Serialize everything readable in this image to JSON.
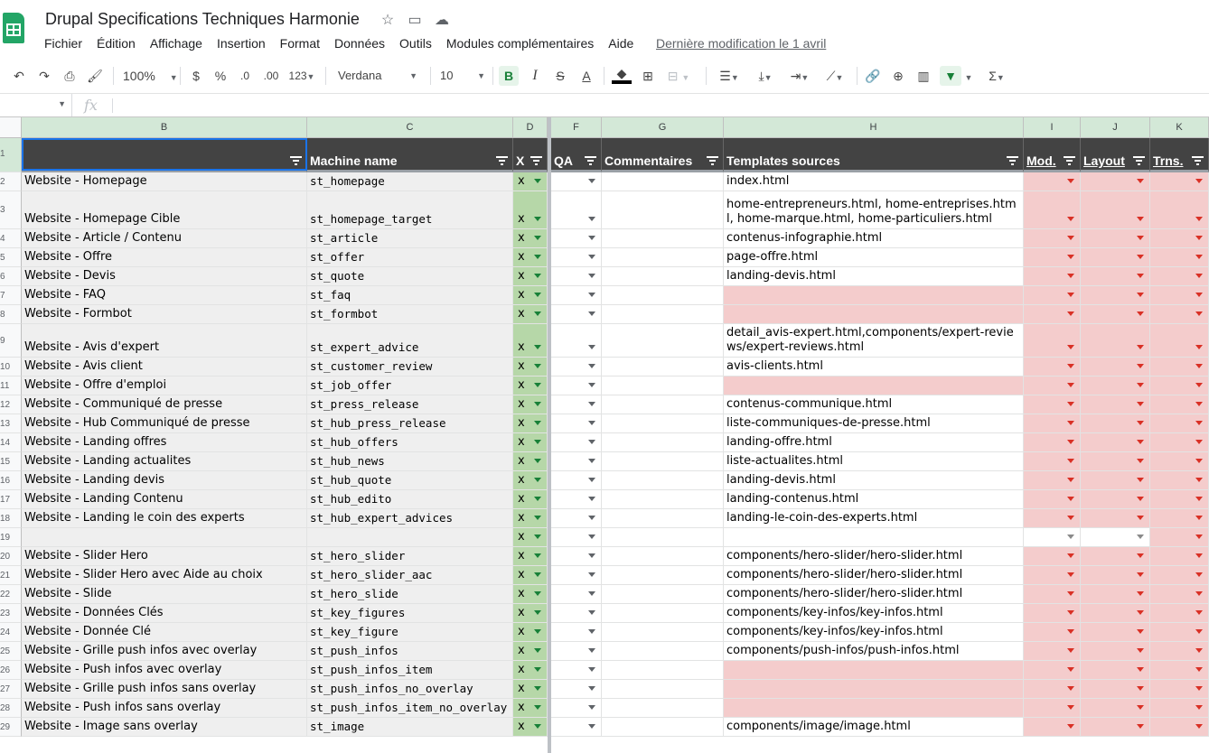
{
  "header": {
    "title": "Drupal Specifications Techniques Harmonie",
    "menus": [
      "Fichier",
      "Édition",
      "Affichage",
      "Insertion",
      "Format",
      "Données",
      "Outils",
      "Modules complémentaires",
      "Aide"
    ],
    "last_modified": "Dernière modification le 1 avril"
  },
  "toolbar": {
    "zoom": "100%",
    "currency": "$",
    "percent": "%",
    "dec_less": ".0",
    "dec_more": ".00",
    "number_format": "123",
    "font": "Verdana",
    "font_size": "10",
    "bold": "B",
    "italic": "I",
    "strike": "S",
    "text_color": "A"
  },
  "formula_bar": {
    "fx": "fx",
    "value": ""
  },
  "columns": [
    "B",
    "C",
    "D",
    "F",
    "G",
    "H",
    "I",
    "J",
    "K"
  ],
  "header_row": {
    "row_number": "1",
    "b": "",
    "c": "Machine name",
    "d": "X",
    "f": "QA",
    "g": "Commentaires",
    "h": "Templates sources",
    "i": "Mod.",
    "j": "Layout",
    "k": "Trns."
  },
  "rows": [
    {
      "n": "2",
      "b": "Website - Homepage",
      "c": "st_homepage",
      "d": "x",
      "h": "index.html",
      "h_pink": false,
      "ij_pink": true
    },
    {
      "n": "3",
      "b": "Website - Homepage Cible",
      "c": "st_homepage_target",
      "d": "x",
      "h": "home-entrepreneurs.html, home-entreprises.html, home-marque.html, home-particuliers.html",
      "h_pink": false,
      "ij_pink": true
    },
    {
      "n": "4",
      "b": "Website - Article / Contenu",
      "c": "st_article",
      "d": "x",
      "h": "contenus-infographie.html",
      "h_pink": false,
      "ij_pink": true
    },
    {
      "n": "5",
      "b": "Website - Offre",
      "c": "st_offer",
      "d": "x",
      "h": "page-offre.html",
      "h_pink": false,
      "ij_pink": true
    },
    {
      "n": "6",
      "b": "Website - Devis",
      "c": "st_quote",
      "d": "x",
      "h": "landing-devis.html",
      "h_pink": false,
      "ij_pink": true
    },
    {
      "n": "7",
      "b": "Website - FAQ",
      "c": "st_faq",
      "d": "x",
      "h": "",
      "h_pink": true,
      "ij_pink": true
    },
    {
      "n": "8",
      "b": "Website - Formbot",
      "c": "st_formbot",
      "d": "x",
      "h": "",
      "h_pink": true,
      "ij_pink": true
    },
    {
      "n": "9",
      "b": "Website - Avis d'expert",
      "c": "st_expert_advice",
      "d": "x",
      "h": "detail_avis-expert.html,components/expert-reviews/expert-reviews.html",
      "h_pink": false,
      "ij_pink": true
    },
    {
      "n": "10",
      "b": "Website - Avis client",
      "c": "st_customer_review",
      "d": "x",
      "h": "avis-clients.html",
      "h_pink": false,
      "ij_pink": true
    },
    {
      "n": "11",
      "b": "Website - Offre d'emploi",
      "c": "st_job_offer",
      "d": "x",
      "h": "",
      "h_pink": true,
      "ij_pink": true
    },
    {
      "n": "12",
      "b": "Website - Communiqué de presse",
      "c": "st_press_release",
      "d": "x",
      "h": "contenus-communique.html",
      "h_pink": false,
      "ij_pink": true
    },
    {
      "n": "13",
      "b": "Website - Hub Communiqué de presse",
      "c": "st_hub_press_release",
      "d": "x",
      "h": "liste-communiques-de-presse.html",
      "h_pink": false,
      "ij_pink": true
    },
    {
      "n": "14",
      "b": "Website - Landing offres",
      "c": "st_hub_offers",
      "d": "x",
      "h": "landing-offre.html",
      "h_pink": false,
      "ij_pink": true
    },
    {
      "n": "15",
      "b": "Website - Landing actualites",
      "c": "st_hub_news",
      "d": "x",
      "h": "liste-actualites.html",
      "h_pink": false,
      "ij_pink": true
    },
    {
      "n": "16",
      "b": "Website - Landing devis",
      "c": "st_hub_quote",
      "d": "x",
      "h": "landing-devis.html",
      "h_pink": false,
      "ij_pink": true
    },
    {
      "n": "17",
      "b": "Website - Landing Contenu",
      "c": "st_hub_edito",
      "d": "x",
      "h": "landing-contenus.html",
      "h_pink": false,
      "ij_pink": true
    },
    {
      "n": "18",
      "b": "Website - Landing le coin des experts",
      "c": "st_hub_expert_advices",
      "d": "x",
      "h": "landing-le-coin-des-experts.html",
      "h_pink": false,
      "ij_pink": true
    },
    {
      "n": "19",
      "b": "",
      "c": "",
      "d": "x",
      "h": "",
      "h_pink": false,
      "ij_pink": false
    },
    {
      "n": "20",
      "b": "Website - Slider Hero",
      "c": "st_hero_slider",
      "d": "x",
      "h": "components/hero-slider/hero-slider.html",
      "h_pink": false,
      "ij_pink": true
    },
    {
      "n": "21",
      "b": "Website - Slider Hero avec Aide au choix",
      "c": "st_hero_slider_aac",
      "d": "x",
      "h": "components/hero-slider/hero-slider.html",
      "h_pink": false,
      "ij_pink": true
    },
    {
      "n": "22",
      "b": "Website - Slide",
      "c": "st_hero_slide",
      "d": "x",
      "h": "components/hero-slider/hero-slider.html",
      "h_pink": false,
      "ij_pink": true
    },
    {
      "n": "23",
      "b": "Website - Données Clés",
      "c": "st_key_figures",
      "d": "x",
      "h": "components/key-infos/key-infos.html",
      "h_pink": false,
      "ij_pink": true
    },
    {
      "n": "24",
      "b": "Website - Donnée Clé",
      "c": "st_key_figure",
      "d": "x",
      "h": "components/key-infos/key-infos.html",
      "h_pink": false,
      "ij_pink": true
    },
    {
      "n": "25",
      "b": "Website - Grille push infos avec overlay",
      "c": "st_push_infos",
      "d": "x",
      "h": "components/push-infos/push-infos.html",
      "h_pink": false,
      "ij_pink": true
    },
    {
      "n": "26",
      "b": "Website - Push infos avec overlay",
      "c": "st_push_infos_item",
      "d": "x",
      "h": "",
      "h_pink": true,
      "ij_pink": true
    },
    {
      "n": "27",
      "b": "Website - Grille push infos sans overlay",
      "c": "st_push_infos_no_overlay",
      "d": "x",
      "h": "",
      "h_pink": true,
      "ij_pink": true
    },
    {
      "n": "28",
      "b": "Website - Push infos sans overlay",
      "c": "st_push_infos_item_no_overlay",
      "d": "x",
      "h": "",
      "h_pink": true,
      "ij_pink": true
    },
    {
      "n": "29",
      "b": "Website - Image sans overlay",
      "c": "st_image",
      "d": "x",
      "h": "components/image/image.html",
      "h_pink": false,
      "ij_pink": true
    }
  ]
}
